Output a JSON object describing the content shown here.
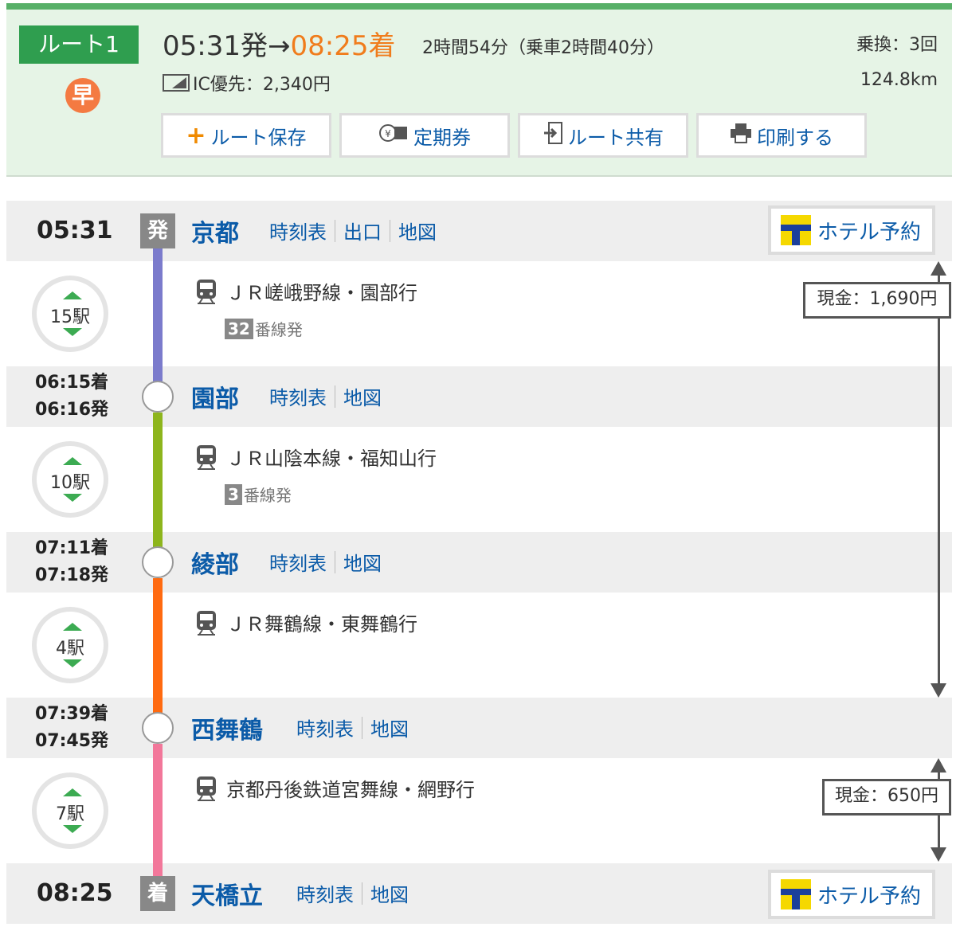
{
  "summary": {
    "route_label": "ルート1",
    "fast_badge": "早",
    "depart_time": "05:31発",
    "arrow": "→",
    "arrive_time": "08:25着",
    "duration": "2時間54分（乗車2時間40分）",
    "transfers": "乗換：3回",
    "ic_fare": "IC優先：2,340円",
    "distance": "124.8km",
    "buttons": {
      "save": "ルート保存",
      "commuter": "定期券",
      "share": "ルート共有",
      "print": "印刷する"
    }
  },
  "stations": [
    {
      "time": "05:31",
      "mark": "発",
      "name": "京都",
      "links": [
        "時刻表",
        "出口",
        "地図"
      ],
      "hotel": "ホテル予約"
    },
    {
      "arr": "06:15着",
      "dep": "06:16発",
      "name": "園部",
      "links": [
        "時刻表",
        "地図"
      ]
    },
    {
      "arr": "07:11着",
      "dep": "07:18発",
      "name": "綾部",
      "links": [
        "時刻表",
        "地図"
      ]
    },
    {
      "arr": "07:39着",
      "dep": "07:45発",
      "name": "西舞鶴",
      "links": [
        "時刻表",
        "地図"
      ]
    },
    {
      "time": "08:25",
      "mark": "着",
      "name": "天橋立",
      "links": [
        "時刻表",
        "地図"
      ],
      "hotel": "ホテル予約"
    }
  ],
  "segments": [
    {
      "stops": "15駅",
      "line": "ＪＲ嵯峨野線・園部行",
      "platform_num": "32",
      "platform_suffix": "番線発",
      "color": "#7b7bcc"
    },
    {
      "stops": "10駅",
      "line": "ＪＲ山陰本線・福知山行",
      "platform_num": "3",
      "platform_suffix": "番線発",
      "color": "#8db51c"
    },
    {
      "stops": "4駅",
      "line": "ＪＲ舞鶴線・東舞鶴行",
      "color": "#ff6a10"
    },
    {
      "stops": "7駅",
      "line": "京都丹後鉄道宮舞線・網野行",
      "color": "#f2779a"
    }
  ],
  "fares": [
    "現金：1,690円",
    "現金：650円"
  ]
}
